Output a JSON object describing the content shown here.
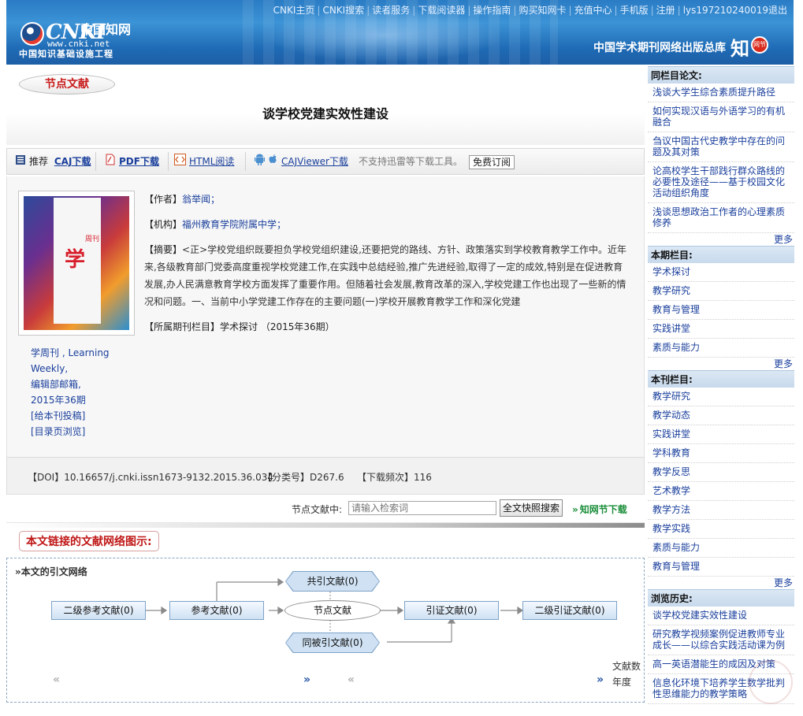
{
  "header": {
    "top_nav": [
      "CNKI主页",
      "CNKI搜索",
      "读者服务",
      "下载阅读器",
      "操作指南",
      "购买知网卡",
      "充值中心",
      "手机版",
      "注册",
      "lys197210240019退出"
    ],
    "logo_text": "CNKI",
    "logo_cn": "中国知网",
    "logo_url": "www.cnki.net",
    "logo_project": "中国知识基础设施工程",
    "slogan": "中国学术期刊网络出版总库",
    "badge_char": "知",
    "badge_dot": "网节"
  },
  "node_badge": "节点文献",
  "article": {
    "title": "谈学校党建实效性建设"
  },
  "download_bar": {
    "recommend": "推荐",
    "caj": "CAJ下载",
    "pdf": "PDF下载",
    "html": "HTML阅读",
    "cajviewer": "CAJViewer下载",
    "note": "不支持迅雷等下载工具。",
    "free_sub": "免费订阅"
  },
  "meta": {
    "author_label": "【作者】",
    "author": "翁举闻；",
    "org_label": "【机构】",
    "org": "福州教育学院附属中学；",
    "abstract_label": "【摘要】",
    "abstract": "<正>学校党组织既要担负学校党组织建设,还要把党的路线、方针、政策落实到学校教育教学工作中。近年来,各级教育部门党委高度重视学校党建工作,在实践中总结经验,推广先进经验,取得了一定的成效,特别是在促进教育发展,办人民满意教育学校方面发挥了重要作用。但随着社会发展,教育改革的深入,学校党建工作也出现了一些新的情况和问题。一、当前中小学党建工作存在的主要问题(一)学校开展教育教学工作和深化党建",
    "column_label": "【所属期刊栏目】",
    "column": "学术探讨 （2015年36期）"
  },
  "journal": {
    "cover_char": "学",
    "cover_small": "周刊",
    "lines": [
      "学周刊 , Learning",
      "Weekly,",
      "编辑部邮箱,",
      "2015年36期",
      "[给本刊投稿]",
      "[目录页浏览]"
    ]
  },
  "doi_bar": {
    "doi": "【DOI】10.16657/j.cnki.issn1673-9132.2015.36.034",
    "class": "【分类号】D267.6",
    "freq": "【下载频次】116"
  },
  "search": {
    "label": "节点文献中:",
    "placeholder": "请输入检索词",
    "button": "全文快照搜索",
    "node_download": "知网节下载"
  },
  "network": {
    "heading": "本文链接的文献网络图示:",
    "sub_title": "»本文的引文网络",
    "nodes": {
      "second_ref": "二级参考文献(0)",
      "ref": "参考文献(0)",
      "center": "节点文献",
      "cite": "引证文献(0)",
      "second_cite": "二级引证文献(0)",
      "co_cite": "共引文献(0)",
      "co_cited": "同被引文献(0)"
    },
    "axis_count": "文献数",
    "axis_year": "年度",
    "nav_prev": "«",
    "nav_next": "»"
  },
  "sidebar": {
    "sections": [
      {
        "head": "同栏目论文:",
        "items": [
          "浅谈大学生综合素质提升路径",
          "如何实现汉语与外语学习的有机融合",
          "刍议中国古代史教学中存在的问题及其对策",
          "论高校学生干部践行群众路线的必要性及途径——基于校园文化活动组织角度",
          "浅谈思想政治工作者的心理素质修养"
        ],
        "more": "更多"
      },
      {
        "head": "本期栏目:",
        "items": [
          "学术探讨",
          "教学研究",
          "教育与管理",
          "实践讲堂",
          "素质与能力"
        ],
        "more": "更多"
      },
      {
        "head": "本刊栏目:",
        "items": [
          "教学研究",
          "教学动态",
          "实践讲堂",
          "学科教育",
          "教学反思",
          "艺术教学",
          "教学方法",
          "教学实践",
          "素质与能力",
          "教育与管理"
        ],
        "more": "更多"
      },
      {
        "head": "浏览历史:",
        "items": [
          "谈学校党建实效性建设",
          "研究教学视频案例促进教师专业成长——以综合实践活动课为例",
          "高一英语潜能生的成因及对策",
          "信息化环境下培养学生数学批判性思维能力的教学策略"
        ],
        "more": ""
      }
    ]
  },
  "colors": {
    "header_blue": "#2a7cc4",
    "link": "#1a3f9c",
    "title_red": "#c01717",
    "node_green": "#1b8f3a"
  }
}
